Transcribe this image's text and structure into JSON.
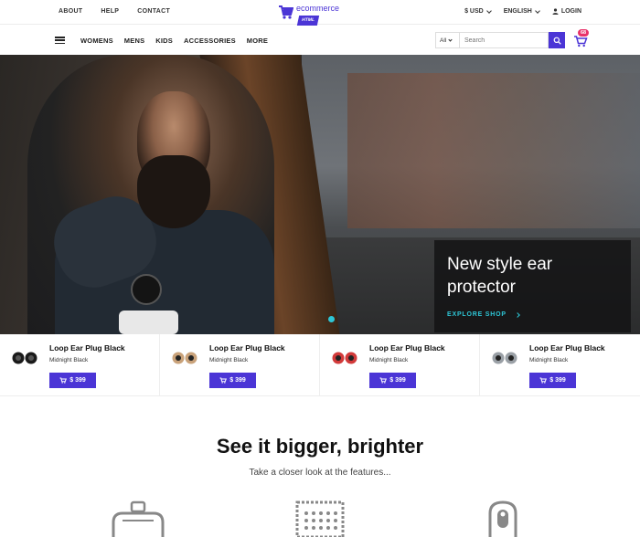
{
  "topbar": {
    "links": [
      "ABOUT",
      "HELP",
      "CONTACT"
    ],
    "logo_text": "ecommerce",
    "logo_badge": "HTML",
    "currency": "$ USD",
    "language": "ENGLISH",
    "login": "LOGIN"
  },
  "nav": {
    "items": [
      "WOMENS",
      "MENS",
      "KIDS",
      "ACCESSORIES",
      "MORE"
    ],
    "search_category": "All",
    "search_placeholder": "Search",
    "cart_count": "68"
  },
  "hero": {
    "title_line1": "New style ear",
    "title_line2": "protector",
    "cta": "EXPLORE SHOP"
  },
  "products": [
    {
      "name": "Loop Ear Plug Black",
      "variant": "Midnight Black",
      "price": "$ 399",
      "accent": "#1a1a1a"
    },
    {
      "name": "Loop Ear Plug Black",
      "variant": "Midnight Black",
      "price": "$ 399",
      "accent": "#c9a27a"
    },
    {
      "name": "Loop Ear Plug Black",
      "variant": "Midnight Black",
      "price": "$ 399",
      "accent": "#d23a3a"
    },
    {
      "name": "Loop Ear Plug Black",
      "variant": "Midnight Black",
      "price": "$ 399",
      "accent": "#9aa0a6"
    }
  ],
  "features": {
    "title": "See it bigger, brighter",
    "subtitle": "Take a closer look at the features...",
    "icons": [
      "vr-headset-icon",
      "smart-card-icon",
      "remote-device-icon"
    ]
  },
  "colors": {
    "primary": "#4b35d6",
    "accent": "#2ec6d6",
    "badge": "#e8336a"
  }
}
